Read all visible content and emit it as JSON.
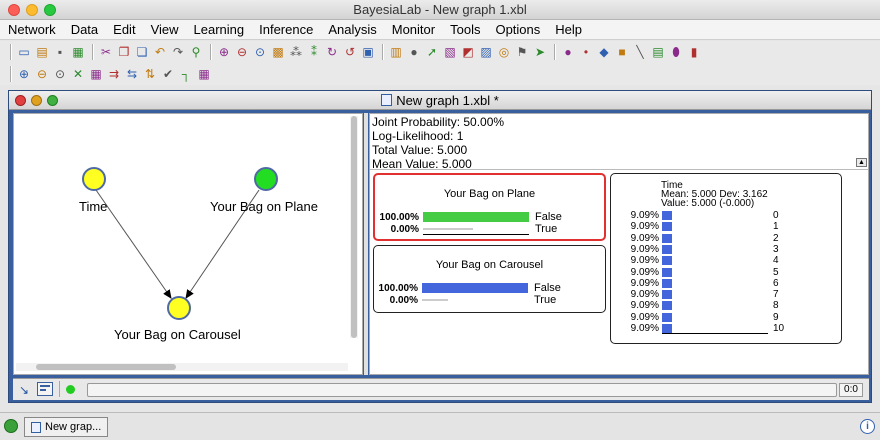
{
  "window": {
    "title": "BayesiaLab - New graph 1.xbl"
  },
  "menu": [
    "Network",
    "Data",
    "Edit",
    "View",
    "Learning",
    "Inference",
    "Analysis",
    "Monitor",
    "Tools",
    "Options",
    "Help"
  ],
  "toolbar1_icons": [
    "new-icon",
    "open-icon",
    "save-icon",
    "print-icon",
    "cut-icon",
    "copy-icon",
    "paste-icon",
    "undo-icon",
    "redo-icon",
    "find-icon",
    "zoom-in-icon",
    "zoom-out-icon",
    "zoom-fit-icon",
    "grid-icon",
    "layout-icon",
    "layout2-icon",
    "refresh-icon",
    "refresh2-icon",
    "monitor-icon",
    "panel-icon",
    "node-icon",
    "arrow-icon",
    "chart-icon",
    "filter-icon",
    "table-icon",
    "target-icon",
    "flag-icon",
    "select-icon",
    "circle-tool-icon",
    "dot-tool-icon",
    "diamond-tool-icon",
    "square-tool-icon",
    "line-tool-icon",
    "note-tool-icon",
    "cylinder-tool-icon",
    "trash-icon"
  ],
  "toolbar2_icons": [
    "zoom-a-icon",
    "zoom-b-icon",
    "zoom-c-icon",
    "tool-a-icon",
    "tool-b-icon",
    "tool-c-icon",
    "tool-d-icon",
    "tool-e-icon",
    "check-icon",
    "tee-icon",
    "grid2-icon"
  ],
  "frame": {
    "title": "New graph 1.xbl *"
  },
  "graph": {
    "nodes": [
      {
        "label": "Time",
        "color": "#ffff22"
      },
      {
        "label": "Your Bag on Plane",
        "color": "#22dd22"
      },
      {
        "label": "Your Bag on Carousel",
        "color": "#ffff22"
      }
    ]
  },
  "stats": {
    "joint": "Joint Probability: 50.00%",
    "loglik": "Log-Likelihood: 1",
    "total": "Total Value: 5.000",
    "mean": "Mean Value: 5.000"
  },
  "monitors": {
    "plane": {
      "title": "Your Bag on Plane",
      "rows": [
        {
          "pct": "100.00%",
          "state": "False",
          "value": 1.0
        },
        {
          "pct": "0.00%",
          "state": "True",
          "value": 0.0
        }
      ]
    },
    "carousel": {
      "title": "Your Bag on Carousel",
      "rows": [
        {
          "pct": "100.00%",
          "state": "False",
          "value": 1.0
        },
        {
          "pct": "0.00%",
          "state": "True",
          "value": 0.0
        }
      ]
    },
    "time": {
      "title": "Time",
      "mean_line": "Mean: 5.000 Dev: 3.162",
      "value_line": "Value: 5.000 (-0.000)",
      "rows": [
        {
          "pct": "9.09%",
          "state": "0"
        },
        {
          "pct": "9.09%",
          "state": "1"
        },
        {
          "pct": "9.09%",
          "state": "2"
        },
        {
          "pct": "9.09%",
          "state": "3"
        },
        {
          "pct": "9.09%",
          "state": "4"
        },
        {
          "pct": "9.09%",
          "state": "5"
        },
        {
          "pct": "9.09%",
          "state": "6"
        },
        {
          "pct": "9.09%",
          "state": "7"
        },
        {
          "pct": "9.09%",
          "state": "8"
        },
        {
          "pct": "9.09%",
          "state": "9"
        },
        {
          "pct": "9.09%",
          "state": "10"
        }
      ],
      "value": 0.0909
    }
  },
  "status": {
    "coords": "0:0"
  },
  "taskbar": {
    "item": "New grap..."
  },
  "colors": {
    "green_bar": "#44cc44",
    "blue_bar": "#4466dd",
    "selected_border": "#e03030"
  }
}
